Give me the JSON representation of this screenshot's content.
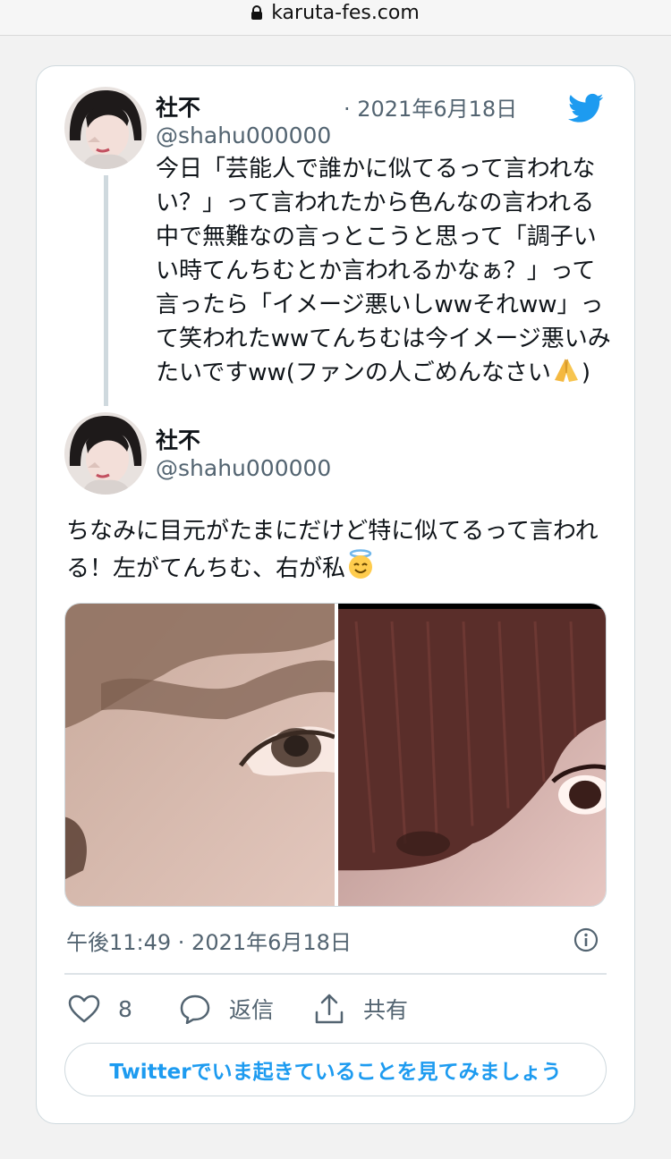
{
  "browser": {
    "url": "karuta-fes.com"
  },
  "tweets": [
    {
      "name": "社不",
      "handle": "@shahu000000",
      "date": "· 2021年6月18日",
      "text": "今日「芸能人で誰かに似てるって言われない？」って言われたから色んなの言われる中で無難なの言っとこうと思って「調子いい時てんちむとか言われるかなぁ？」って言ったら「イメージ悪いしwwそれww」って笑われたwwてんちむは今イメージ悪いみたいですww(ファンの人ごめんなさい",
      "text_end": ")",
      "emoji": "folded-hands"
    },
    {
      "name": "社不",
      "handle": "@shahu000000",
      "text": "ちなみに目元がたまにだけど特に似てるって言われる！左がてんちむ、右が私",
      "emoji": "smiling-face-with-halo",
      "timestamp": "午後11:49 · 2021年6月18日"
    }
  ],
  "actions": {
    "like_count": "8",
    "reply_label": "返信",
    "share_label": "共有"
  },
  "cta": "Twitterでいま起きていることを見てみましょう",
  "colors": {
    "accent": "#1d9bf0",
    "secondary_text": "#536471",
    "border": "#cfd9de"
  }
}
